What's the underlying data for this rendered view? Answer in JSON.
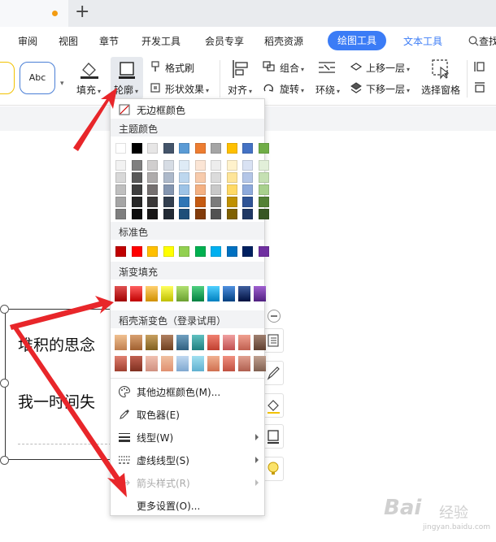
{
  "menu": {
    "items": [
      "审阅",
      "视图",
      "章节",
      "开发工具",
      "会员专享",
      "稻壳资源"
    ],
    "active_tab": "绘图工具",
    "text_tools": "文本工具",
    "search": "查找"
  },
  "ribbon": {
    "style_sample": "Abc",
    "fill_label": "填充",
    "outline_label": "轮廓",
    "format_painter": "格式刷",
    "shape_effects": "形状效果",
    "align_label": "对齐",
    "group_label": "组合",
    "rotate_label": "旋转",
    "wrap_label": "环绕",
    "bring_forward": "上移一层",
    "send_backward": "下移一层",
    "selection_pane": "选择窗格"
  },
  "document": {
    "line1": "堆积的思念",
    "line2": "我一时间失"
  },
  "dropdown": {
    "no_border": "无边框颜色",
    "theme_colors_title": "主题颜色",
    "standard_colors_title": "标准色",
    "gradient_title": "渐变填充",
    "docer_gradient_title": "稻壳渐变色（登录试用）",
    "more_colors": "其他边框颜色(M)...",
    "eyedropper": "取色器(E)",
    "line_type": "线型(W)",
    "dash_type": "虚线线型(S)",
    "arrow_style": "箭头样式(R)",
    "more_settings": "更多设置(O)...",
    "theme_top": [
      "#ffffff",
      "#000000",
      "#e7e6e6",
      "#44546a",
      "#5b9bd5",
      "#ed7d31",
      "#a5a5a5",
      "#ffc000",
      "#4472c4",
      "#70ad47"
    ],
    "theme_shades": [
      [
        "#f2f2f2",
        "#7f7f7f",
        "#d0cece",
        "#d6dce4",
        "#deebf6",
        "#fbe5d5",
        "#ededed",
        "#fff2cc",
        "#d9e2f3",
        "#e2efd9"
      ],
      [
        "#d8d8d8",
        "#595959",
        "#aeabab",
        "#adb9ca",
        "#bdd7ee",
        "#f7cbac",
        "#dbdbdb",
        "#fee599",
        "#b4c6e7",
        "#c5e0b3"
      ],
      [
        "#bfbfbf",
        "#3f3f3f",
        "#757070",
        "#8496b0",
        "#9dc3e6",
        "#f4b183",
        "#c9c9c9",
        "#ffd965",
        "#8eaadb",
        "#a8d08d"
      ],
      [
        "#a5a5a5",
        "#262626",
        "#3a3838",
        "#323f4f",
        "#2e75b5",
        "#c55a11",
        "#7b7b7b",
        "#bf9000",
        "#2f5496",
        "#538135"
      ],
      [
        "#7f7f7f",
        "#0c0c0c",
        "#171616",
        "#222a35",
        "#1e4e79",
        "#833c0b",
        "#525252",
        "#7f6000",
        "#1f3864",
        "#375623"
      ]
    ],
    "standard": [
      "#c00000",
      "#ff0000",
      "#ffc000",
      "#ffff00",
      "#92d050",
      "#00b050",
      "#00b0f0",
      "#0070c0",
      "#002060",
      "#7030a0"
    ],
    "gradients": [
      [
        "#e05050",
        "#a00000"
      ],
      [
        "#ff6060",
        "#c00000"
      ],
      [
        "#ffd070",
        "#d09000"
      ],
      [
        "#ffff60",
        "#c0c000"
      ],
      [
        "#b0e070",
        "#6aa030"
      ],
      [
        "#50d080",
        "#008040"
      ],
      [
        "#50d0ff",
        "#0080c0"
      ],
      [
        "#5090e0",
        "#004080"
      ],
      [
        "#4060a0",
        "#001040"
      ],
      [
        "#a060d0",
        "#502080"
      ]
    ],
    "docer_row1": [
      [
        "#f0c090",
        "#c08050"
      ],
      [
        "#d8a070",
        "#a06030"
      ],
      [
        "#c8a060",
        "#806020"
      ],
      [
        "#b08060",
        "#704020"
      ],
      [
        "#70a0c0",
        "#306080"
      ],
      [
        "#60c0c0",
        "#208080"
      ],
      [
        "#f08070",
        "#c04030"
      ],
      [
        "#f0a0a0",
        "#c05050"
      ],
      [
        "#f0a090",
        "#c06050"
      ],
      [
        "#a08070",
        "#604030"
      ]
    ],
    "docer_row2": [
      [
        "#e08070",
        "#a04030"
      ],
      [
        "#c06050",
        "#803020"
      ],
      [
        "#f0c0b0",
        "#d09080"
      ],
      [
        "#f0c0a0",
        "#e09070"
      ],
      [
        "#c0d8f0",
        "#80a8d0"
      ],
      [
        "#a0e0f0",
        "#60b0d0"
      ],
      [
        "#f0b090",
        "#d07050"
      ],
      [
        "#f09080",
        "#c05040"
      ],
      [
        "#e0a090",
        "#b06050"
      ],
      [
        "#c0a090",
        "#806050"
      ]
    ]
  },
  "watermark": {
    "brand": "Bai",
    "cn": "经验",
    "url": "jingyan.baidu.com"
  }
}
